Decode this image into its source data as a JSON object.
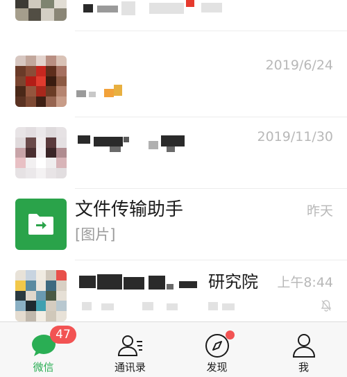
{
  "chats": [
    {
      "id": "chat-0",
      "name": "",
      "preview": "",
      "time": ""
    },
    {
      "id": "chat-1",
      "name": "",
      "preview": "",
      "time": "2019/6/24"
    },
    {
      "id": "chat-2",
      "name": "",
      "preview": "",
      "time": "2019/11/30"
    },
    {
      "id": "chat-3",
      "name": "文件传输助手",
      "preview": "[图片]",
      "time": "昨天"
    },
    {
      "id": "chat-4",
      "name": "研究院",
      "preview": "",
      "time": "上午8:44"
    }
  ],
  "tabs": [
    {
      "label": "微信",
      "icon": "chat-bubble-icon",
      "badge": "47",
      "active": true
    },
    {
      "label": "通讯录",
      "icon": "contacts-icon",
      "badge": "",
      "active": false
    },
    {
      "label": "发现",
      "icon": "compass-icon",
      "badge": "dot",
      "active": false
    },
    {
      "label": "我",
      "icon": "person-icon",
      "badge": "",
      "active": false
    }
  ],
  "colors": {
    "accent": "#2aae54",
    "badge": "#f25353",
    "file_helper": "#2aa34a"
  }
}
